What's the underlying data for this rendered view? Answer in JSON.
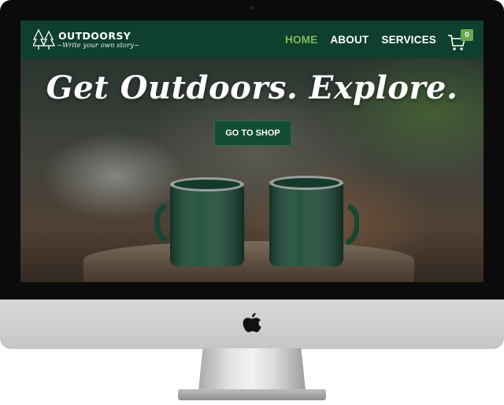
{
  "site": {
    "brand_name": "OUTDOORSY",
    "tagline": "~Write your own story~"
  },
  "nav": {
    "items": [
      {
        "label": "HOME",
        "active": true
      },
      {
        "label": "ABOUT",
        "active": false
      },
      {
        "label": "SERVICES",
        "active": false
      }
    ],
    "cart_count": "0"
  },
  "hero": {
    "headline": "Get Outdoors. Explore.",
    "cta_label": "GO TO SHOP"
  },
  "colors": {
    "navbar": "#0f3f2d",
    "accent_green": "#7fb95a",
    "cta_button": "#124c33"
  },
  "icons": [
    "trees-icon",
    "cart-icon",
    "apple-logo-icon"
  ]
}
